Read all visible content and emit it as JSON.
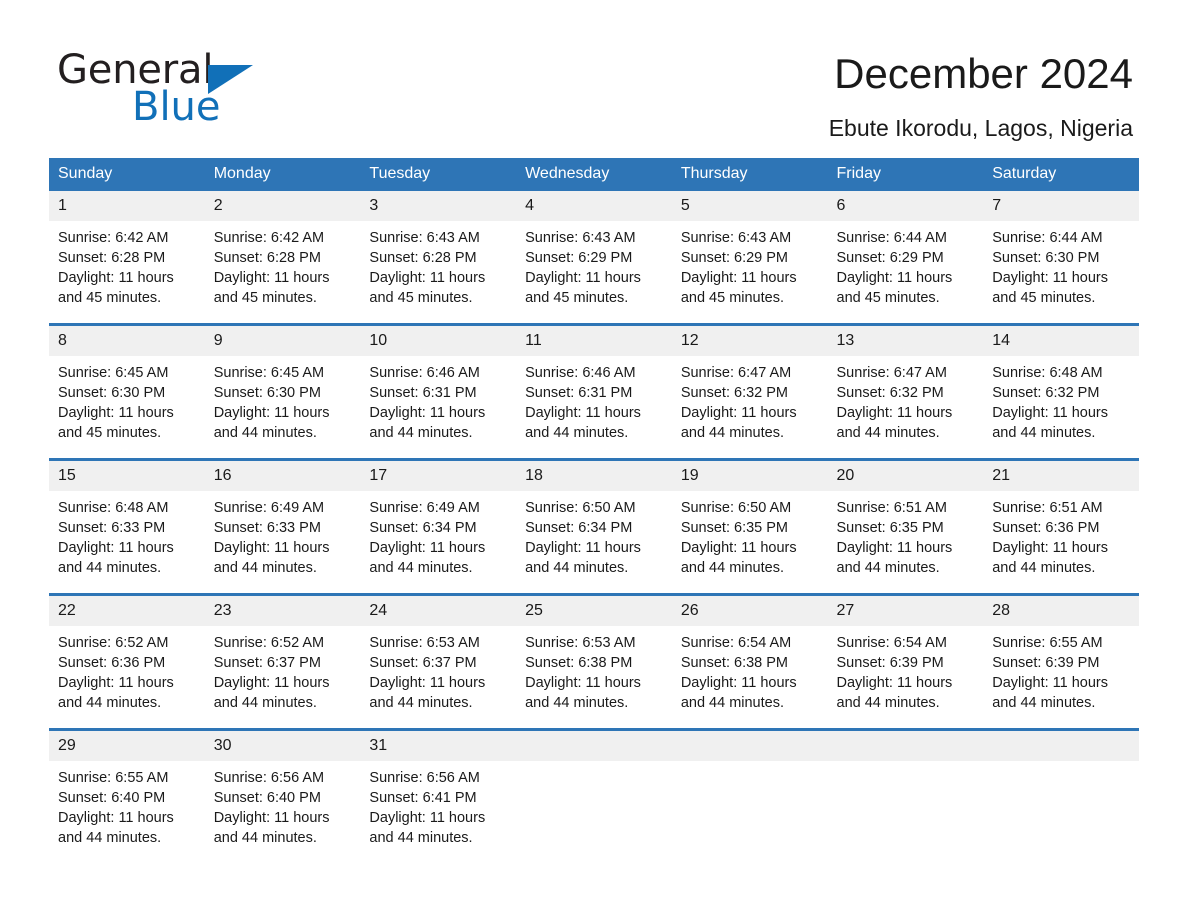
{
  "brand": {
    "name_first": "General",
    "name_second": "Blue",
    "accent_color": "#1170b8"
  },
  "header": {
    "title": "December 2024",
    "location": "Ebute Ikorodu, Lagos, Nigeria"
  },
  "theme": {
    "header_row_color": "#2e75b6",
    "daynum_band_color": "#f0f0f0",
    "text_color": "#1a1a1a"
  },
  "calendar": {
    "weekday_headers": [
      "Sunday",
      "Monday",
      "Tuesday",
      "Wednesday",
      "Thursday",
      "Friday",
      "Saturday"
    ],
    "weeks": [
      [
        {
          "day": "1",
          "sunrise": "Sunrise: 6:42 AM",
          "sunset": "Sunset: 6:28 PM",
          "daylight": "Daylight: 11 hours and 45 minutes."
        },
        {
          "day": "2",
          "sunrise": "Sunrise: 6:42 AM",
          "sunset": "Sunset: 6:28 PM",
          "daylight": "Daylight: 11 hours and 45 minutes."
        },
        {
          "day": "3",
          "sunrise": "Sunrise: 6:43 AM",
          "sunset": "Sunset: 6:28 PM",
          "daylight": "Daylight: 11 hours and 45 minutes."
        },
        {
          "day": "4",
          "sunrise": "Sunrise: 6:43 AM",
          "sunset": "Sunset: 6:29 PM",
          "daylight": "Daylight: 11 hours and 45 minutes."
        },
        {
          "day": "5",
          "sunrise": "Sunrise: 6:43 AM",
          "sunset": "Sunset: 6:29 PM",
          "daylight": "Daylight: 11 hours and 45 minutes."
        },
        {
          "day": "6",
          "sunrise": "Sunrise: 6:44 AM",
          "sunset": "Sunset: 6:29 PM",
          "daylight": "Daylight: 11 hours and 45 minutes."
        },
        {
          "day": "7",
          "sunrise": "Sunrise: 6:44 AM",
          "sunset": "Sunset: 6:30 PM",
          "daylight": "Daylight: 11 hours and 45 minutes."
        }
      ],
      [
        {
          "day": "8",
          "sunrise": "Sunrise: 6:45 AM",
          "sunset": "Sunset: 6:30 PM",
          "daylight": "Daylight: 11 hours and 45 minutes."
        },
        {
          "day": "9",
          "sunrise": "Sunrise: 6:45 AM",
          "sunset": "Sunset: 6:30 PM",
          "daylight": "Daylight: 11 hours and 44 minutes."
        },
        {
          "day": "10",
          "sunrise": "Sunrise: 6:46 AM",
          "sunset": "Sunset: 6:31 PM",
          "daylight": "Daylight: 11 hours and 44 minutes."
        },
        {
          "day": "11",
          "sunrise": "Sunrise: 6:46 AM",
          "sunset": "Sunset: 6:31 PM",
          "daylight": "Daylight: 11 hours and 44 minutes."
        },
        {
          "day": "12",
          "sunrise": "Sunrise: 6:47 AM",
          "sunset": "Sunset: 6:32 PM",
          "daylight": "Daylight: 11 hours and 44 minutes."
        },
        {
          "day": "13",
          "sunrise": "Sunrise: 6:47 AM",
          "sunset": "Sunset: 6:32 PM",
          "daylight": "Daylight: 11 hours and 44 minutes."
        },
        {
          "day": "14",
          "sunrise": "Sunrise: 6:48 AM",
          "sunset": "Sunset: 6:32 PM",
          "daylight": "Daylight: 11 hours and 44 minutes."
        }
      ],
      [
        {
          "day": "15",
          "sunrise": "Sunrise: 6:48 AM",
          "sunset": "Sunset: 6:33 PM",
          "daylight": "Daylight: 11 hours and 44 minutes."
        },
        {
          "day": "16",
          "sunrise": "Sunrise: 6:49 AM",
          "sunset": "Sunset: 6:33 PM",
          "daylight": "Daylight: 11 hours and 44 minutes."
        },
        {
          "day": "17",
          "sunrise": "Sunrise: 6:49 AM",
          "sunset": "Sunset: 6:34 PM",
          "daylight": "Daylight: 11 hours and 44 minutes."
        },
        {
          "day": "18",
          "sunrise": "Sunrise: 6:50 AM",
          "sunset": "Sunset: 6:34 PM",
          "daylight": "Daylight: 11 hours and 44 minutes."
        },
        {
          "day": "19",
          "sunrise": "Sunrise: 6:50 AM",
          "sunset": "Sunset: 6:35 PM",
          "daylight": "Daylight: 11 hours and 44 minutes."
        },
        {
          "day": "20",
          "sunrise": "Sunrise: 6:51 AM",
          "sunset": "Sunset: 6:35 PM",
          "daylight": "Daylight: 11 hours and 44 minutes."
        },
        {
          "day": "21",
          "sunrise": "Sunrise: 6:51 AM",
          "sunset": "Sunset: 6:36 PM",
          "daylight": "Daylight: 11 hours and 44 minutes."
        }
      ],
      [
        {
          "day": "22",
          "sunrise": "Sunrise: 6:52 AM",
          "sunset": "Sunset: 6:36 PM",
          "daylight": "Daylight: 11 hours and 44 minutes."
        },
        {
          "day": "23",
          "sunrise": "Sunrise: 6:52 AM",
          "sunset": "Sunset: 6:37 PM",
          "daylight": "Daylight: 11 hours and 44 minutes."
        },
        {
          "day": "24",
          "sunrise": "Sunrise: 6:53 AM",
          "sunset": "Sunset: 6:37 PM",
          "daylight": "Daylight: 11 hours and 44 minutes."
        },
        {
          "day": "25",
          "sunrise": "Sunrise: 6:53 AM",
          "sunset": "Sunset: 6:38 PM",
          "daylight": "Daylight: 11 hours and 44 minutes."
        },
        {
          "day": "26",
          "sunrise": "Sunrise: 6:54 AM",
          "sunset": "Sunset: 6:38 PM",
          "daylight": "Daylight: 11 hours and 44 minutes."
        },
        {
          "day": "27",
          "sunrise": "Sunrise: 6:54 AM",
          "sunset": "Sunset: 6:39 PM",
          "daylight": "Daylight: 11 hours and 44 minutes."
        },
        {
          "day": "28",
          "sunrise": "Sunrise: 6:55 AM",
          "sunset": "Sunset: 6:39 PM",
          "daylight": "Daylight: 11 hours and 44 minutes."
        }
      ],
      [
        {
          "day": "29",
          "sunrise": "Sunrise: 6:55 AM",
          "sunset": "Sunset: 6:40 PM",
          "daylight": "Daylight: 11 hours and 44 minutes."
        },
        {
          "day": "30",
          "sunrise": "Sunrise: 6:56 AM",
          "sunset": "Sunset: 6:40 PM",
          "daylight": "Daylight: 11 hours and 44 minutes."
        },
        {
          "day": "31",
          "sunrise": "Sunrise: 6:56 AM",
          "sunset": "Sunset: 6:41 PM",
          "daylight": "Daylight: 11 hours and 44 minutes."
        },
        {
          "day": "",
          "sunrise": "",
          "sunset": "",
          "daylight": ""
        },
        {
          "day": "",
          "sunrise": "",
          "sunset": "",
          "daylight": ""
        },
        {
          "day": "",
          "sunrise": "",
          "sunset": "",
          "daylight": ""
        },
        {
          "day": "",
          "sunrise": "",
          "sunset": "",
          "daylight": ""
        }
      ]
    ]
  }
}
